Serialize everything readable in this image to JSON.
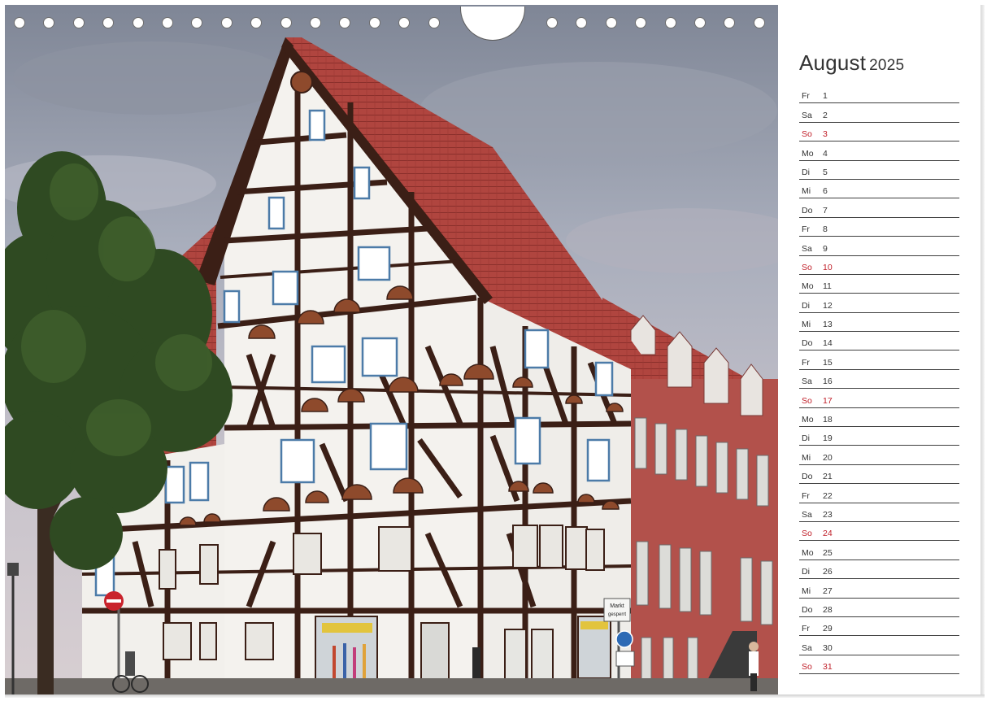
{
  "calendar": {
    "month": "August",
    "year": "2025",
    "sunday_color": "#c0202a",
    "days": [
      {
        "wd": "Fr",
        "d": "1"
      },
      {
        "wd": "Sa",
        "d": "2"
      },
      {
        "wd": "So",
        "d": "3"
      },
      {
        "wd": "Mo",
        "d": "4"
      },
      {
        "wd": "Di",
        "d": "5"
      },
      {
        "wd": "Mi",
        "d": "6"
      },
      {
        "wd": "Do",
        "d": "7"
      },
      {
        "wd": "Fr",
        "d": "8"
      },
      {
        "wd": "Sa",
        "d": "9"
      },
      {
        "wd": "So",
        "d": "10"
      },
      {
        "wd": "Mo",
        "d": "11"
      },
      {
        "wd": "Di",
        "d": "12"
      },
      {
        "wd": "Mi",
        "d": "13"
      },
      {
        "wd": "Do",
        "d": "14"
      },
      {
        "wd": "Fr",
        "d": "15"
      },
      {
        "wd": "Sa",
        "d": "16"
      },
      {
        "wd": "So",
        "d": "17"
      },
      {
        "wd": "Mo",
        "d": "18"
      },
      {
        "wd": "Di",
        "d": "19"
      },
      {
        "wd": "Mi",
        "d": "20"
      },
      {
        "wd": "Do",
        "d": "21"
      },
      {
        "wd": "Fr",
        "d": "22"
      },
      {
        "wd": "Sa",
        "d": "23"
      },
      {
        "wd": "So",
        "d": "24"
      },
      {
        "wd": "Mo",
        "d": "25"
      },
      {
        "wd": "Di",
        "d": "26"
      },
      {
        "wd": "Mi",
        "d": "27"
      },
      {
        "wd": "Do",
        "d": "28"
      },
      {
        "wd": "Fr",
        "d": "29"
      },
      {
        "wd": "Sa",
        "d": "30"
      },
      {
        "wd": "So",
        "d": "31"
      }
    ]
  },
  "photo": {
    "sign_markt": "Markt",
    "sign_gesperrt": "gesperrt"
  }
}
